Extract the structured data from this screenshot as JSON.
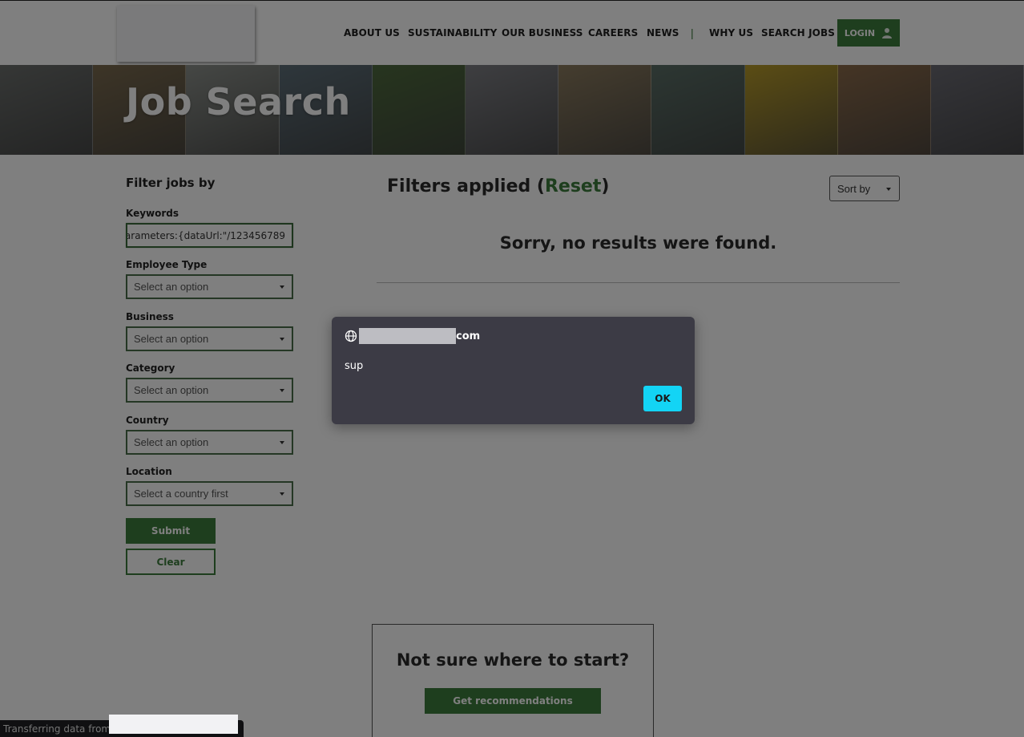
{
  "header": {
    "nav": [
      {
        "label": "ABOUT US",
        "name": "nav-about-us"
      },
      {
        "label": "SUSTAINABILITY",
        "name": "nav-sustainability"
      },
      {
        "label": "OUR BUSINESS",
        "name": "nav-our-business"
      },
      {
        "label": "CAREERS",
        "name": "nav-careers"
      },
      {
        "label": "NEWS",
        "name": "nav-news"
      },
      {
        "label": "WHY US",
        "name": "nav-why-us"
      },
      {
        "label": "SEARCH JOBS",
        "name": "nav-search-jobs"
      }
    ],
    "divider": "|",
    "login_label": "LOGIN",
    "login_icon": "user-icon"
  },
  "hero": {
    "title": "Job Search",
    "tile_colors": [
      "#6b6e6c",
      "#7a6a4e",
      "#8b8f8a",
      "#5d6e78",
      "#4e6a3e",
      "#7c7d82",
      "#8a7a5e",
      "#5a6e66",
      "#b69a2a",
      "#8a6a4a",
      "#6a6a72"
    ]
  },
  "sidebar": {
    "title": "Filter jobs by",
    "keywords": {
      "label": "Keywords",
      "value": "'arameters:{dataUrl:\"/123456789"
    },
    "employee_type": {
      "label": "Employee Type",
      "value": "Select an option"
    },
    "business": {
      "label": "Business",
      "value": "Select an option"
    },
    "category": {
      "label": "Category",
      "value": "Select an option"
    },
    "country": {
      "label": "Country",
      "value": "Select an option"
    },
    "location": {
      "label": "Location",
      "value": "Select a country first"
    },
    "submit_label": "Submit",
    "clear_label": "Clear"
  },
  "main": {
    "filters_prefix": "Filters applied (",
    "reset_label": "Reset",
    "filters_suffix": ")",
    "sort_label": "Sort by",
    "no_results": "Sorry, no results were found.",
    "reco_title": "Not sure where to start?",
    "reco_button": "Get recommendations"
  },
  "dialog": {
    "origin_icon": "globe-icon",
    "origin_suffix": "com",
    "message": "sup",
    "ok_label": "OK"
  },
  "status_bar": {
    "text": "Transferring data from"
  },
  "colors": {
    "brand_green": "#3c7d3c",
    "dialog_bg": "#3c3b45",
    "ok_button": "#13d4f5"
  }
}
